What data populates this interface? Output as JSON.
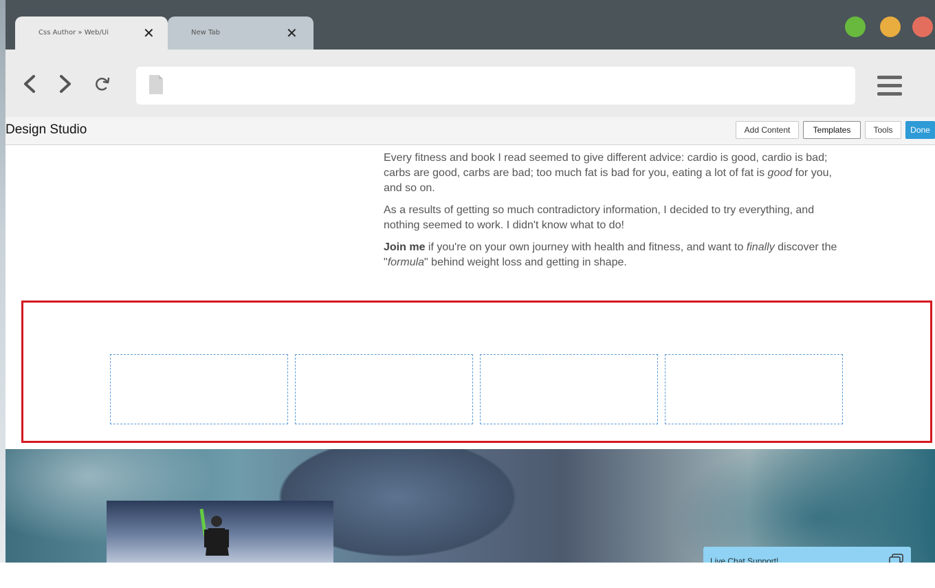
{
  "browser": {
    "tabs": [
      {
        "label": "Css Author » Web/Ui",
        "close": "✕"
      },
      {
        "label": "New Tab",
        "close": "✕"
      }
    ],
    "window_controls": [
      "green",
      "yellow",
      "red"
    ]
  },
  "toolbar": {
    "back_icon": "chevron-left-icon",
    "forward_icon": "chevron-right-icon",
    "reload_icon": "reload-icon",
    "address_value": "",
    "menu_icon": "hamburger-menu-icon"
  },
  "editor": {
    "title": "Design Studio",
    "buttons": {
      "add_content": "Add Content",
      "templates": "Templates",
      "tools": "Tools",
      "done": "Done"
    }
  },
  "article": {
    "p1": "Every fitness and book I read seemed to give different advice: cardio is good, cardio is bad; carbs are good, carbs are bad; too much fat is bad for you, eating a lot of fat is ",
    "p1_em": "good",
    "p1_end": " for you, and so on.",
    "p2": "As a results  of getting so much contradictory information, I decided to try everything, and nothing seemed to work. I didn't know what to do!",
    "p3_strong": "Join me",
    "p3_a": " if you're on your own journey with health and fitness, and want to ",
    "p3_em1": "finally",
    "p3_b": " discover the \"",
    "p3_em2": "formula",
    "p3_c": "\" behind weight loss and getting in shape."
  },
  "chat": {
    "label": "Live Chat Support!"
  },
  "colors": {
    "tabbar_bg": "#4a5459",
    "selection_border": "#d3181f",
    "slot_border": "#5b9bd5",
    "done_button": "#2e9ad6",
    "chat_bg": "#8fd2f4"
  }
}
